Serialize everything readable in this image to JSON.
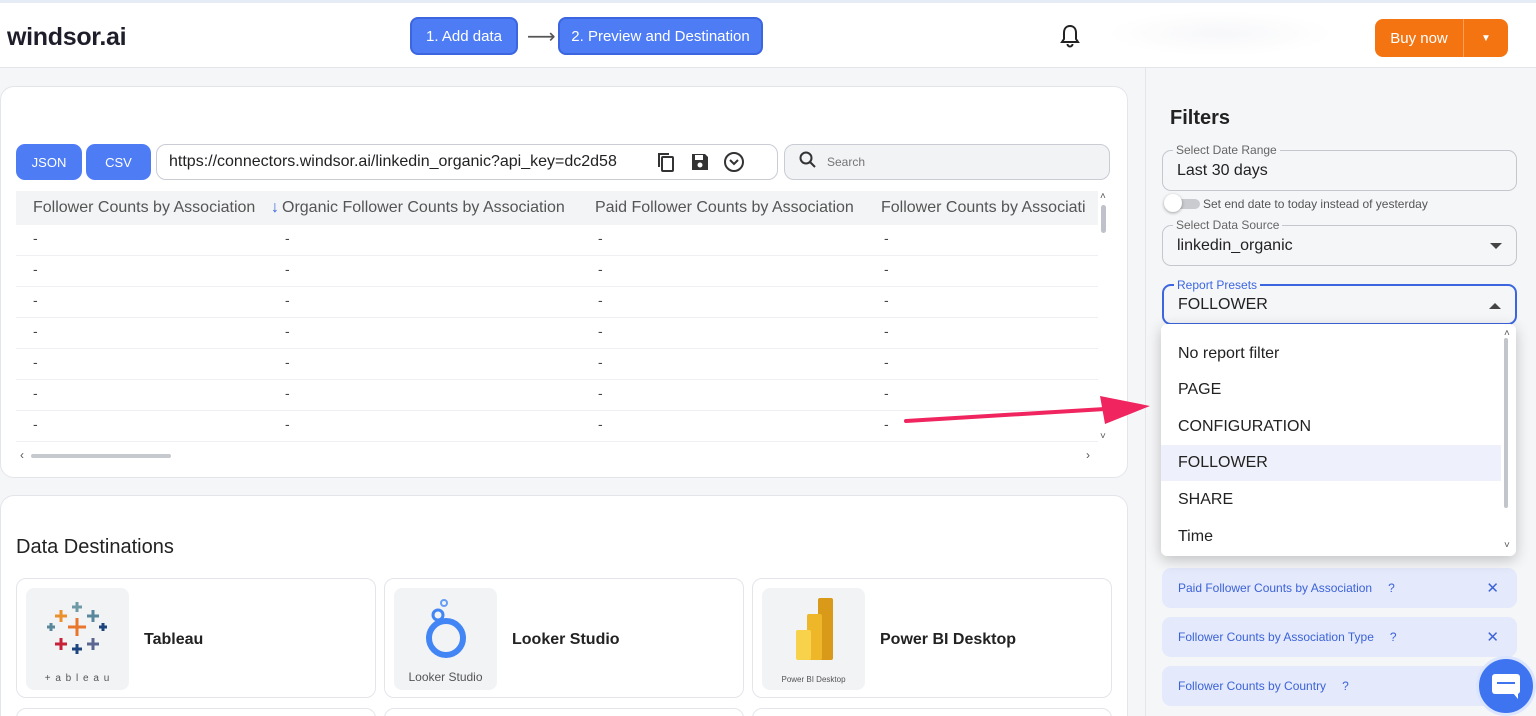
{
  "header": {
    "logo": "windsor.ai",
    "step1": "1. Add data",
    "step2": "2. Preview and Destination",
    "buy_label": "Buy now"
  },
  "preview": {
    "json_label": "JSON",
    "csv_label": "CSV",
    "url": "https://connectors.windsor.ai/linkedin_organic?api_key=dc2d58",
    "search_placeholder": "Search",
    "columns": [
      "Follower Counts by Association",
      "Organic Follower Counts by Association",
      "Paid Follower Counts by Association",
      "Follower Counts by Associati"
    ],
    "sort_indicator": "↓",
    "rows": [
      [
        "-",
        "-",
        "-",
        "-"
      ],
      [
        "-",
        "-",
        "-",
        "-"
      ],
      [
        "-",
        "-",
        "-",
        "-"
      ],
      [
        "-",
        "-",
        "-",
        "-"
      ],
      [
        "-",
        "-",
        "-",
        "-"
      ],
      [
        "-",
        "-",
        "-",
        "-"
      ],
      [
        "-",
        "-",
        "-",
        "-"
      ]
    ]
  },
  "destinations": {
    "title": "Data Destinations",
    "items": [
      {
        "name": "Tableau",
        "logo_caption": "+ a b l e a u"
      },
      {
        "name": "Looker Studio",
        "logo_caption": "Looker Studio"
      },
      {
        "name": "Power BI Desktop",
        "logo_caption": "Power BI Desktop"
      }
    ]
  },
  "filters": {
    "title": "Filters",
    "date_range": {
      "label": "Select Date Range",
      "value": "Last 30 days"
    },
    "toggle_label": "Set end date to today instead of yesterday",
    "data_source": {
      "label": "Select Data Source",
      "value": "linkedin_organic"
    },
    "presets": {
      "label": "Report Presets",
      "value": "FOLLOWER"
    },
    "preset_options": [
      "No report filter",
      "PAGE",
      "CONFIGURATION",
      "FOLLOWER",
      "SHARE",
      "Time"
    ],
    "selected_chips": [
      "Paid Follower Counts by Association",
      "Follower Counts by Association Type",
      "Follower Counts by Country"
    ],
    "chip_help": "?",
    "chip_remove": "✕"
  },
  "colors": {
    "primary": "#4d7cf5",
    "buy": "#f47412",
    "annotation_arrow": "#f0245e"
  }
}
